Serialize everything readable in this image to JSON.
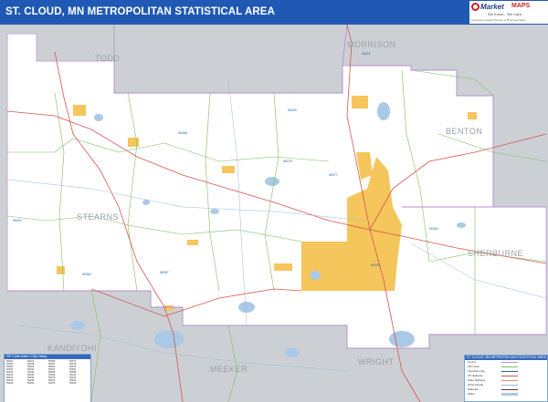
{
  "title": "ST. CLOUD, MN METROPOLITAN STATISTICAL AREA",
  "logo": {
    "brand": "Market",
    "brand2": "MAPS",
    "tagline": "We Know... We Care.",
    "small": "America's Leading Source of Business Maps"
  },
  "counties": {
    "todd": "TODD",
    "morrison": "MORRISON",
    "benton": "BENTON",
    "stearns": "STEARNS",
    "sherburne": "SHERBURNE",
    "kandiyohi": "KANDIYOHI",
    "meeker": "MEEKER",
    "wright": "WRIGHT"
  },
  "road_labels": [
    "56301",
    "56303",
    "56304",
    "56320",
    "56340",
    "56352",
    "56368",
    "56377",
    "56379",
    "56387"
  ],
  "legend": {
    "header": "ST. CLOUD, MN METROPOLITAN STATISTICAL AREA",
    "rows": [
      "County",
      "ZIP Code",
      "Interstate Hwy",
      "US Highway",
      "State Highway",
      "Other Roads",
      "Railroad",
      "Water"
    ]
  },
  "index": {
    "header": "ZIP Code Index / City Listing",
    "col1": [
      "56301",
      "56303",
      "56304",
      "56307",
      "56310",
      "56312",
      "56314",
      "56316",
      "56320"
    ],
    "col2": [
      "56321",
      "56325",
      "56329",
      "56330",
      "56333",
      "56335",
      "56340",
      "56345",
      "56352"
    ],
    "col3": [
      "56356",
      "56357",
      "56362",
      "56367",
      "56368",
      "56369",
      "56373",
      "56374",
      "56376"
    ],
    "col4": [
      "56377",
      "56378",
      "56379",
      "56387",
      "56388",
      "55310",
      "55319",
      "55320",
      "55330"
    ]
  },
  "colors": {
    "title_bg": "#1f59b3",
    "outside": "#ccd0d4",
    "msa": "#ffffff",
    "urban": "#f5c65c",
    "water": "#a9c9e6",
    "highway": "#d9534f",
    "border": "#7fbf60"
  }
}
